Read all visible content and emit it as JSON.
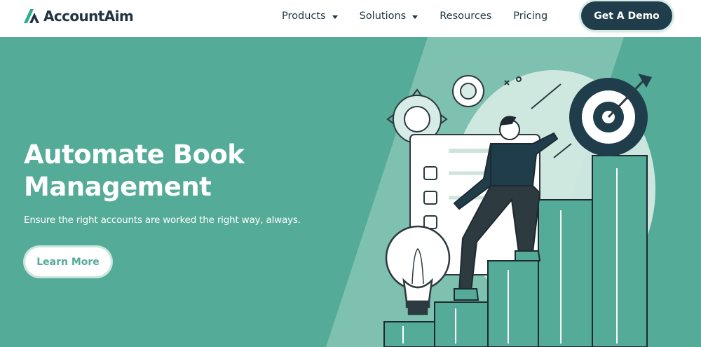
{
  "header": {
    "logo_text": "AccountAim",
    "nav": [
      {
        "label": "Products",
        "has_dropdown": true
      },
      {
        "label": "Solutions",
        "has_dropdown": true
      },
      {
        "label": "Resources",
        "has_dropdown": false
      },
      {
        "label": "Pricing",
        "has_dropdown": false
      }
    ],
    "cta_label": "Get A Demo"
  },
  "hero": {
    "title_line1": "Automate Book",
    "title_line2": "Management",
    "subtitle": "Ensure the right accounts are worked the right way, always.",
    "button_label": "Learn More"
  },
  "colors": {
    "brand_teal": "#54ab98",
    "dark_navy": "#1f3d4a",
    "logo_text": "#1f3440",
    "white": "#ffffff"
  },
  "icons": {
    "logo": "accountaim-logo-mark",
    "dropdown": "caret-down-icon",
    "illustration": "person-climbing-bar-chart-to-target"
  }
}
